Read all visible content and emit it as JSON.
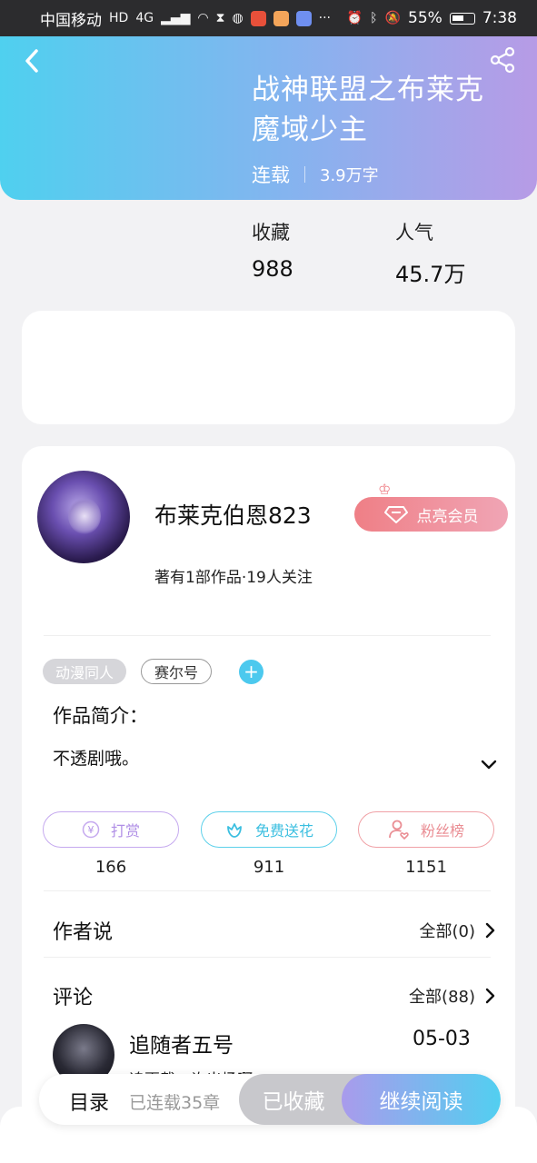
{
  "status_bar": {
    "carrier": "中国移动",
    "network": "4G",
    "battery": "55%",
    "time": "7:38"
  },
  "book": {
    "title": "战神联盟之布莱克魔域少主",
    "status": "连载",
    "word_count": "3.9万字"
  },
  "stats": [
    {
      "label": "收藏",
      "value": "988"
    },
    {
      "label": "人气",
      "value": "45.7万"
    }
  ],
  "author": {
    "name": "布莱克伯恩823",
    "info": "著有1部作品·19人关注",
    "vip_button": "点亮会员"
  },
  "tags": [
    "动漫同人",
    "赛尔号"
  ],
  "intro": {
    "title": "作品简介：",
    "text": "不透剧哦。"
  },
  "support": [
    {
      "label": "打赏",
      "count": "166",
      "icon": "yen-coin-icon"
    },
    {
      "label": "免费送花",
      "count": "911",
      "icon": "flower-icon"
    },
    {
      "label": "粉丝榜",
      "count": "1151",
      "icon": "user-heart-icon"
    }
  ],
  "author_says": {
    "title": "作者说",
    "more": "全部(0)"
  },
  "comments": {
    "title": "评论",
    "more": "全部(88)",
    "first": {
      "name": "追随者五号",
      "date": "05-03",
      "text": "追更截…许出场啊"
    }
  },
  "bottom_bar": {
    "catalog": "目录",
    "serial": "已连载35章",
    "collected": "已收藏",
    "continue": "继续阅读"
  },
  "colors": {
    "hero_start": "#4fd0ef",
    "hero_end": "#b79be6",
    "vip": "#ef7f86",
    "accent_blue": "#4cc9ee"
  }
}
